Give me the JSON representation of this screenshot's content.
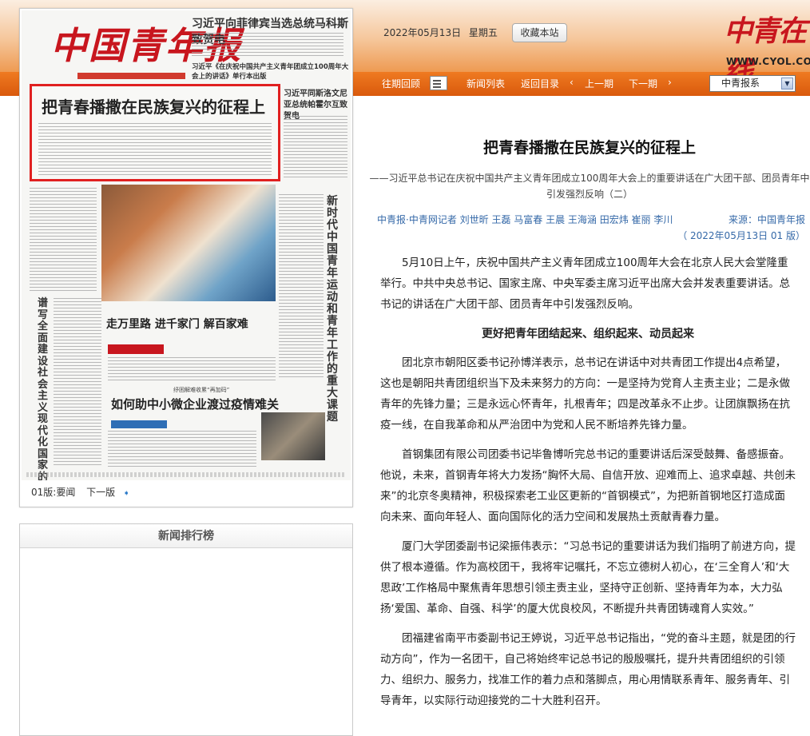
{
  "header": {
    "date": "2022年05月13日",
    "weekday": "星期五",
    "favorite_button": "收藏本站",
    "logo_text": "中青在线",
    "logo_url": "WWW.CYOL.COM"
  },
  "nav": {
    "items": [
      "往期回顾",
      "新闻列表",
      "返回目录",
      "‹",
      "上一期",
      "下一期",
      "›"
    ],
    "select_value": "中青报系"
  },
  "paper": {
    "masthead": "中国青年报",
    "top_headline": "习近平向菲律宾当选总统马科斯致贺电",
    "top_subhead": "习近平《在庆祝中国共产主义青年团成立100周年大会上的讲话》单行本出版",
    "highlight_title": "把青春播撒在民族复兴的征程上",
    "highlight_sub": "——习近平总书记在庆祝中国共产主义青年团成立100周年大会上的重要讲话在广大团干部、团员青年中引发强烈反响（二）",
    "right_headline": "习近平同斯洛文尼亚总统帕霍尔互致贺电",
    "vertical_right": "新时代中国青年运动和青年工作的重大课题",
    "vertical_left": "谱写全面建设社会主义现代化国家的青春篇章",
    "mid_headline": "走万里路 进千家门 解百家难",
    "mid_kicker": "纾困解难收累“再加码”",
    "mid_headline2": "如何助中小微企业渡过疫情难关",
    "page_label": "01版:要闻",
    "next_label": "下一版"
  },
  "ranking": {
    "title": "新闻排行榜"
  },
  "article": {
    "title": "把青春播撒在民族复兴的征程上",
    "subtitle": "——习近平总书记在庆祝中国共产主义青年团成立100周年大会上的重要讲话在广大团干部、团员青年中引发强烈反响（二）",
    "authors": "中青报·中青网记者 刘世昕 王磊 马富春 王晨 王海涵 田宏炜 崔丽 李川",
    "source": "来源：中国青年报",
    "edition": "（ 2022年05月13日    01 版）",
    "paragraphs": [
      "5月10日上午，庆祝中国共产主义青年团成立100周年大会在北京人民大会堂隆重举行。中共中央总书记、国家主席、中央军委主席习近平出席大会并发表重要讲话。总书记的讲话在广大团干部、团员青年中引发强烈反响。",
      "更好把青年团结起来、组织起来、动员起来",
      "团北京市朝阳区委书记孙博洋表示，总书记在讲话中对共青团工作提出4点希望，这也是朝阳共青团组织当下及未来努力的方向：一是坚持为党育人主责主业；二是永做青年的先锋力量；三是永远心怀青年，扎根青年；四是改革永不止步。让团旗飘扬在抗疫一线，在自我革命和从严治团中为党和人民不断培养先锋力量。",
      "首钢集团有限公司团委书记毕鲁博听完总书记的重要讲话后深受鼓舞、备感振奋。他说，未来，首钢青年将大力发扬“胸怀大局、自信开放、迎难而上、追求卓越、共创未来”的北京冬奥精神，积极探索老工业区更新的“首钢模式”，为把新首钢地区打造成面向未来、面向年轻人、面向国际化的活力空间和发展热土贡献青春力量。",
      "厦门大学团委副书记梁振伟表示：“习总书记的重要讲话为我们指明了前进方向，提供了根本遵循。作为高校团干，我将牢记嘱托，不忘立德树人初心，在‘三全育人’和‘大思政’工作格局中聚焦青年思想引领主责主业，坚持守正创新、坚持青年为本，大力弘扬‘爱国、革命、自强、科学’的厦大优良校风，不断提升共青团铸魂育人实效。”",
      "团福建省南平市委副书记王婷说，习近平总书记指出，“党的奋斗主题，就是团的行动方向”，作为一名团干，自己将始终牢记总书记的殷殷嘱托，提升共青团组织的引领力、组织力、服务力，找准工作的着力点和落脚点，用心用情联系青年、服务青年、引导青年，以实际行动迎接党的二十大胜利召开。"
    ]
  },
  "colors": {
    "accent": "#e8701c",
    "brand_red": "#c8161e",
    "link_blue": "#3569a8"
  }
}
